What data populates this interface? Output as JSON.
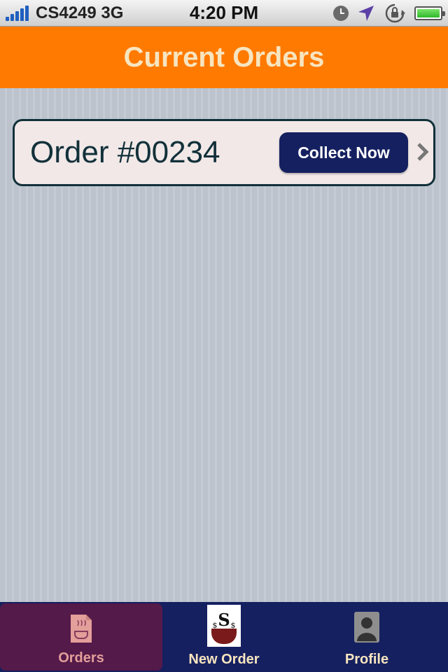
{
  "status_bar": {
    "carrier": "CS4249 3G",
    "time": "4:20 PM",
    "icons": [
      "signal-icon",
      "clock-icon",
      "location-arrow-icon",
      "rotation-lock-icon",
      "battery-icon"
    ]
  },
  "nav": {
    "title": "Current Orders"
  },
  "orders": [
    {
      "title": "Order #00234",
      "action_label": "Collect Now"
    }
  ],
  "tabs": [
    {
      "label": "Orders",
      "icon": "orders-icon",
      "selected": true
    },
    {
      "label": "New Order",
      "icon": "new-order-icon",
      "selected": false
    },
    {
      "label": "Profile",
      "icon": "profile-icon",
      "selected": false
    }
  ],
  "colors": {
    "nav_background": "#ff7a00",
    "nav_title": "#f7e5c0",
    "tab_bar": "#152060",
    "tab_selected": "#541a49",
    "button": "#152060"
  }
}
